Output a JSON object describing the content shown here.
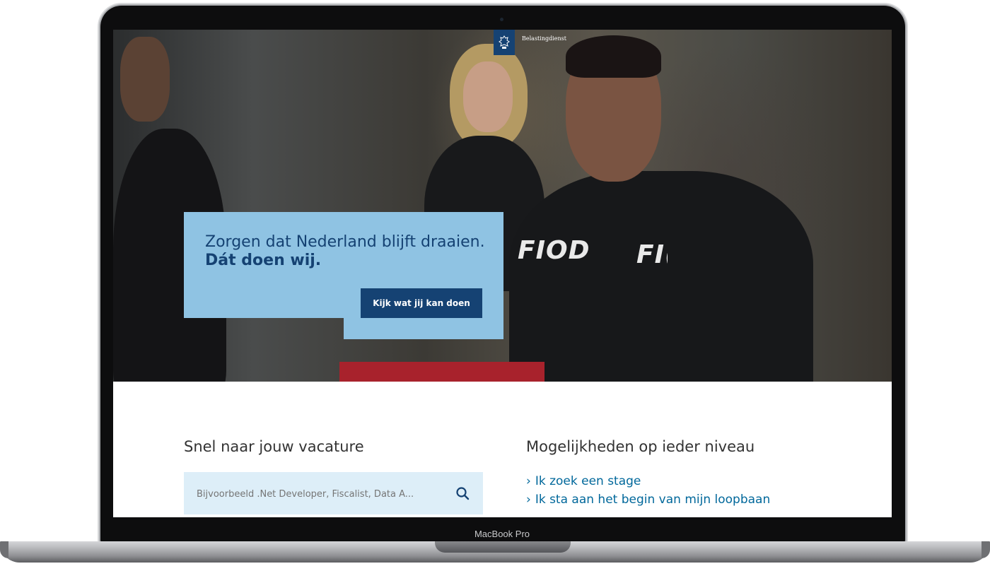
{
  "header": {
    "brand_name": "Belastingdienst",
    "brand_color": "#154273"
  },
  "hero": {
    "title_regular": "Zorgen dat Nederland blijft draaien.",
    "title_bold": "Dát doen wij.",
    "cta_label": "Kijk wat jij kan doen",
    "badge_texts": [
      "FIOD",
      "FI("
    ],
    "panel_color": "#8fc3e3"
  },
  "search_section": {
    "heading": "Snel naar jouw vacature",
    "placeholder": "Bijvoorbeeld .Net Developer, Fiscalist, Data A...",
    "icon": "search-icon"
  },
  "levels_section": {
    "heading": "Mogelijkheden op ieder niveau",
    "links": [
      {
        "label": "Ik zoek een stage"
      },
      {
        "label": "Ik sta aan het begin van mijn loopbaan"
      }
    ],
    "link_color": "#01689b"
  },
  "device": {
    "label": "MacBook Pro"
  }
}
